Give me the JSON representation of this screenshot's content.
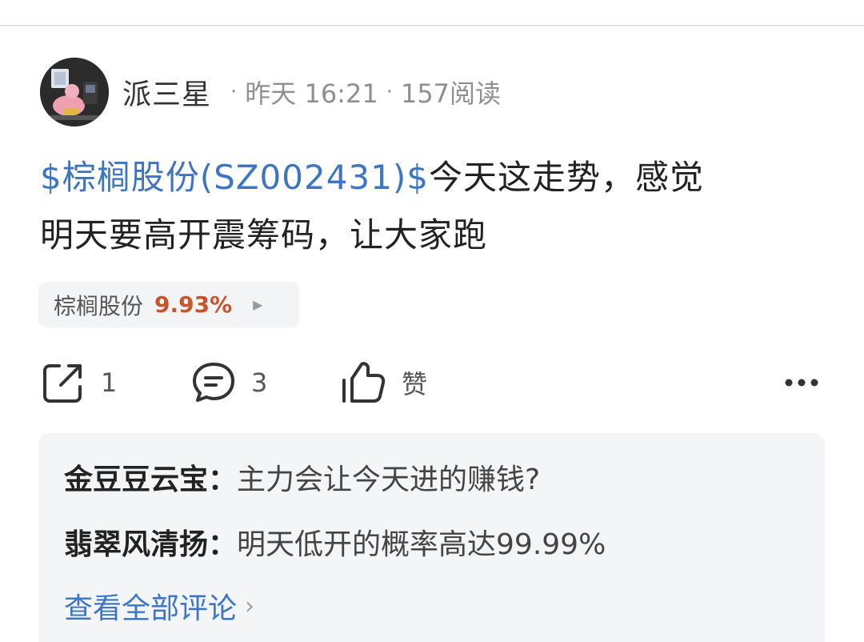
{
  "post": {
    "author": "派三星",
    "time": "昨天 16:21",
    "reads": "157阅读",
    "separator": "·",
    "stock_link": "$棕榈股份(SZ002431)$",
    "text_line1": "今天这走势，感觉",
    "text_line2": "明天要高开震筹码，让大家跑"
  },
  "stock_chip": {
    "name": "棕榈股份",
    "change": "9.93%",
    "change_color": "#c8532d"
  },
  "actions": {
    "share_icon": "share-icon",
    "share_count": "1",
    "comment_icon": "comment-icon",
    "comment_count": "3",
    "like_icon": "thumbs-up-icon",
    "like_label": "赞",
    "more_icon": "more-icon"
  },
  "comments": [
    {
      "author": "金豆豆云宝：",
      "text": "主力会让今天进的赚钱?"
    },
    {
      "author": "翡翠风清扬：",
      "text": "明天低开的概率高达99.99%"
    }
  ],
  "view_all": {
    "label": "查看全部评论",
    "arrow": "›"
  },
  "colors": {
    "link": "#3d75c5",
    "up": "#c8532d",
    "comment_bg": "#f4f5f7"
  }
}
